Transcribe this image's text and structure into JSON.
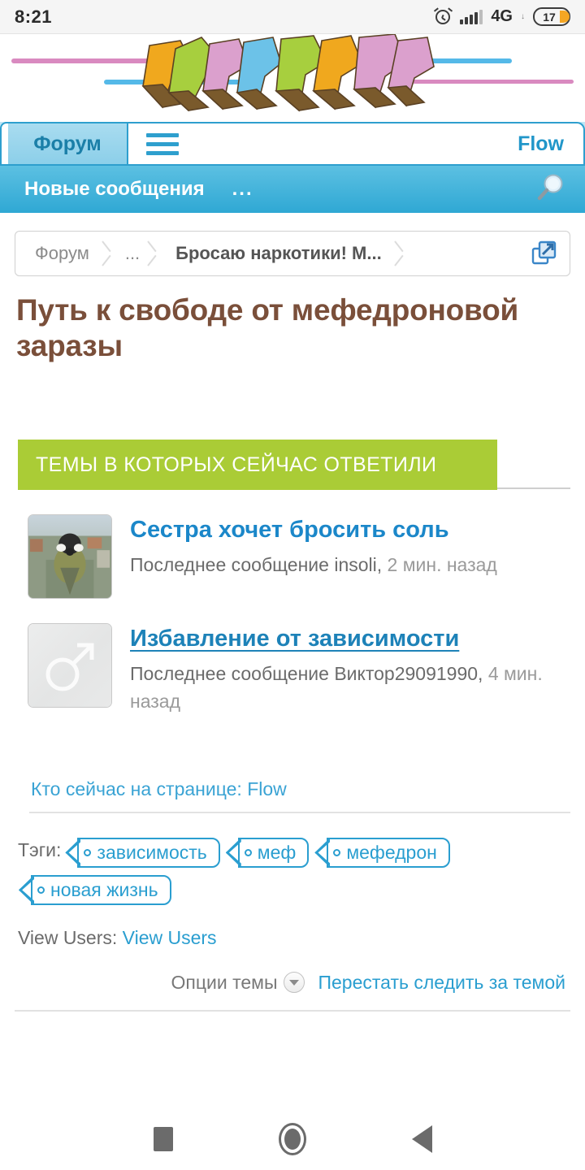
{
  "status_bar": {
    "time": "8:21",
    "network": "4G",
    "battery_level": "17",
    "icons": [
      "alarm-icon",
      "signal-icon",
      "network-icon",
      "battery-icon"
    ]
  },
  "banner": {
    "logo_alt": "graffiti-logo"
  },
  "nav": {
    "active_tab": "Форум",
    "menu_icon": "hamburger-icon",
    "user": "Flow"
  },
  "subnav": {
    "title": "Новые сообщения",
    "more": "...",
    "search_icon": "search-icon"
  },
  "breadcrumb": {
    "items": [
      {
        "label": "Форум"
      },
      {
        "label": "..."
      },
      {
        "label": "Бросаю наркотики! М..."
      }
    ],
    "popout_icon": "external-link-icon"
  },
  "page_title": "Путь к свободе от мефедроновой заразы",
  "section": {
    "heading": "ТЕМЫ В КОТОРЫХ СЕЙЧАС ОТВЕТИЛИ"
  },
  "threads": [
    {
      "title": "Сестра хочет бросить соль",
      "last_prefix": "Последнее сообщение",
      "author": "insoli",
      "time_ago": "2 мин. назад",
      "avatar_type": "photo",
      "visited": false
    },
    {
      "title": "Избавление от зависимости",
      "last_prefix": "Последнее сообщение",
      "author": "Виктор29091990",
      "time_ago": "4 мин. назад",
      "avatar_type": "default-male",
      "visited": true
    }
  ],
  "online": {
    "text": "Кто сейчас на странице: Flow"
  },
  "tags": {
    "label": "Тэги:",
    "items": [
      "зависимость",
      "меф",
      "мефедрон",
      "новая жизнь"
    ]
  },
  "view_users": {
    "label": "View Users:",
    "link": "View Users"
  },
  "options": {
    "label": "Опции темы",
    "caret_icon": "chevron-down-icon",
    "unwatch_link": "Перестать следить за темой"
  },
  "android_nav": {
    "recents": "recents-icon",
    "home": "home-icon",
    "back": "back-icon"
  },
  "colors": {
    "accent_blue": "#2a9ed0",
    "header_blue": "#2fa8d4",
    "green": "#aacc36",
    "title_brown": "#7a4f3a"
  }
}
